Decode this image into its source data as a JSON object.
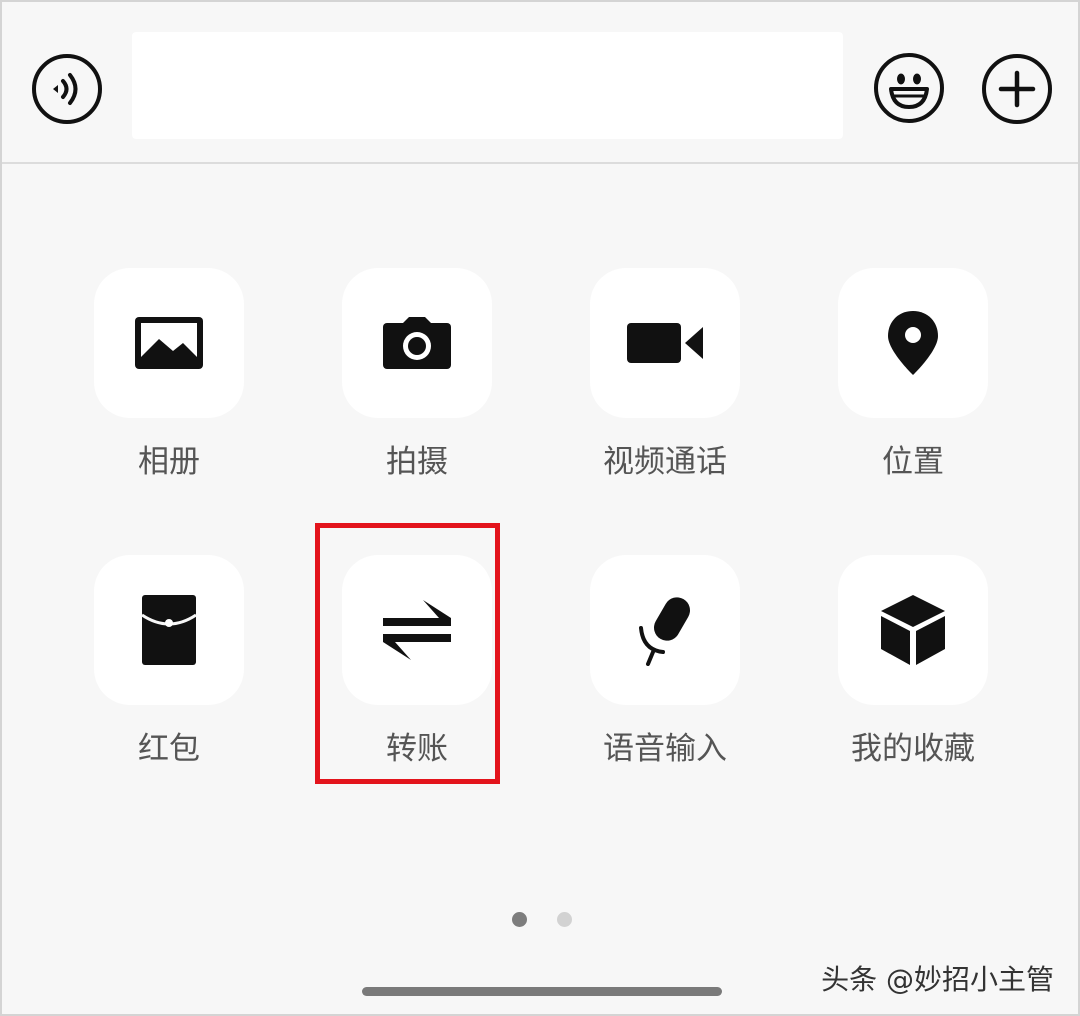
{
  "input_bar": {
    "text_value": ""
  },
  "grid": {
    "items": [
      {
        "label": "相册",
        "icon": "photo-album-icon"
      },
      {
        "label": "拍摄",
        "icon": "camera-icon"
      },
      {
        "label": "视频通话",
        "icon": "video-call-icon"
      },
      {
        "label": "位置",
        "icon": "location-pin-icon"
      },
      {
        "label": "红包",
        "icon": "red-packet-icon"
      },
      {
        "label": "转账",
        "icon": "transfer-icon"
      },
      {
        "label": "语音输入",
        "icon": "microphone-icon"
      },
      {
        "label": "我的收藏",
        "icon": "favorites-box-icon"
      }
    ],
    "highlighted_item": "转账"
  },
  "pager": {
    "current_page": 1,
    "total_pages": 2
  },
  "watermark": "头条 @妙招小主管",
  "colors": {
    "highlight_border": "#e3141c",
    "icon": "#111111",
    "label": "#555555",
    "panel_background": "#f7f7f7",
    "tile_background": "#ffffff"
  }
}
